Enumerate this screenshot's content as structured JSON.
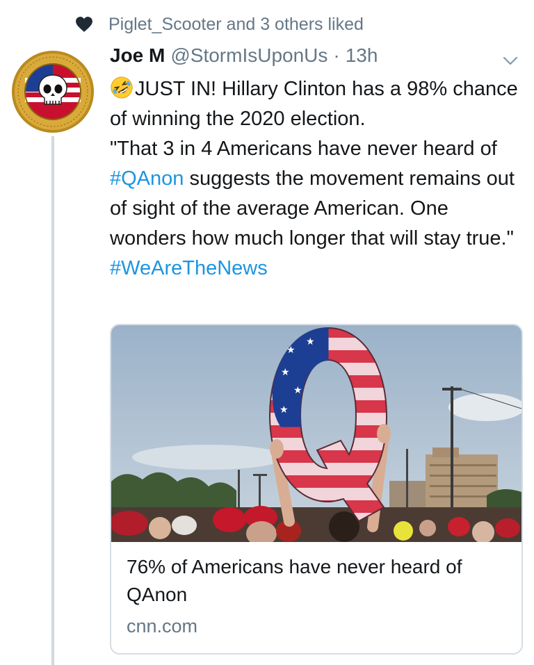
{
  "social_context": {
    "icon": "heart-icon",
    "text": "Piglet_Scooter and 3 others liked"
  },
  "tweet": {
    "display_name": "Joe M",
    "handle": "@StormIsUponUs",
    "separator": "·",
    "time": "13h",
    "avatar_icon": "skull-flag-emblem-avatar",
    "emoji_icon": "rolling-on-floor-laughing-emoji",
    "body_line1": "JUST IN! Hillary Clinton has a 98% chance of winning the 2020 election.",
    "body_quote_before": "\"That 3 in 4 Americans have never heard of ",
    "hashtag1": "#QAnon",
    "body_quote_after": " suggests the movement remains out of sight of the average American. One wonders how much longer that will stay true.\"",
    "hashtag2": "#WeAreTheNews"
  },
  "link_card": {
    "image_icon": "flag-q-sign-rally-photo",
    "title": "76% of Americans have never heard of QAnon",
    "domain": "cnn.com"
  },
  "colors": {
    "hashtag": "#1b95e0",
    "secondary_text": "#657786",
    "thread_line": "#cfd9de"
  }
}
